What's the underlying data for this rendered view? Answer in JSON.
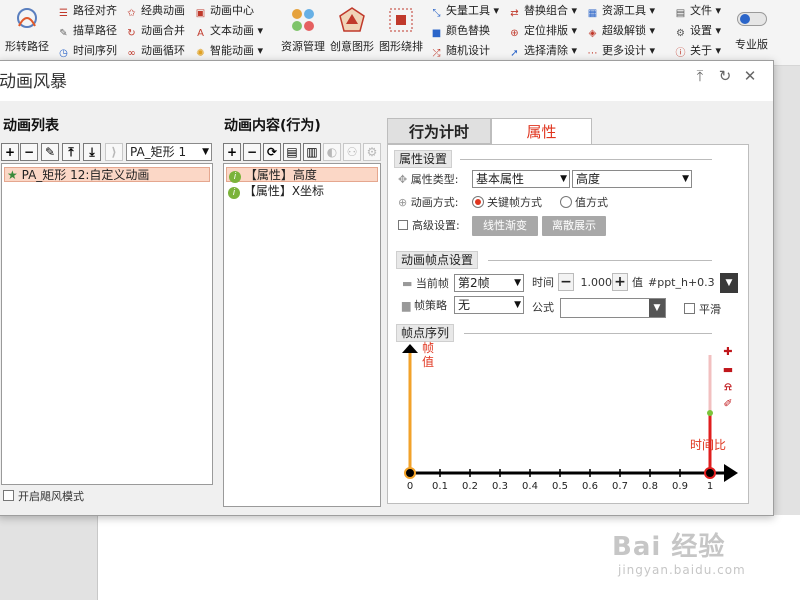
{
  "ribbon": {
    "big_left_label": "形转路径",
    "col1": [
      "路径对齐",
      "描草路径",
      "时间序列"
    ],
    "col2": [
      "经典动画",
      "动画合并",
      "动画循环"
    ],
    "col3": [
      "动画中心",
      "文本动画",
      "智能动画"
    ],
    "big_items": [
      "资源管理",
      "创意图形",
      "图形绕排"
    ],
    "col4": [
      "矢量工具",
      "颜色替换",
      "随机设计"
    ],
    "col5": [
      "替换组合",
      "定位排版",
      "选择清除"
    ],
    "col6": [
      "资源工具",
      "超级解锁",
      "更多设计"
    ],
    "col7": [
      "文件",
      "设置",
      "关于"
    ],
    "pro_label": "专业版"
  },
  "dialog": {
    "title": "动画风暴",
    "left": {
      "heading": "动画列表",
      "dropdown_value": "PA_矩形 1",
      "items": [
        "PA_矩形 12:自定义动画"
      ],
      "footer_checkbox": "开启飓风模式"
    },
    "middle": {
      "heading": "动画内容(行为)",
      "items": [
        "【属性】高度",
        "【属性】X坐标"
      ]
    },
    "tabs": [
      "行为计时",
      "属性"
    ],
    "props": {
      "section_title": "属性设置",
      "type_label": "属性类型:",
      "type_value": "基本属性",
      "attr_value": "高度",
      "mode_label": "动画方式:",
      "mode_keyframe": "关键帧方式",
      "mode_value": "值方式",
      "adv_label": "高级设置:",
      "btn_linear": "线性渐变",
      "btn_discrete": "离散展示"
    },
    "frame": {
      "section_title": "动画帧点设置",
      "current_label": "当前帧",
      "current_value": "第2帧",
      "time_label": "时间",
      "time_value": "1.000",
      "value_label": "值",
      "value_text": "#ppt_h+0.3",
      "strategy_label": "帧策略",
      "strategy_value": "无",
      "formula_label": "公式",
      "smooth_label": "平滑"
    },
    "sequence": {
      "section_title": "帧点序列",
      "y_label": "帧值",
      "x_label": "时间比",
      "ticks": [
        "0",
        "0.1",
        "0.2",
        "0.3",
        "0.4",
        "0.5",
        "0.6",
        "0.7",
        "0.8",
        "0.9",
        "1"
      ]
    }
  },
  "watermark": {
    "main": "Bai 经验",
    "sub": "jingyan.baidu.com"
  }
}
